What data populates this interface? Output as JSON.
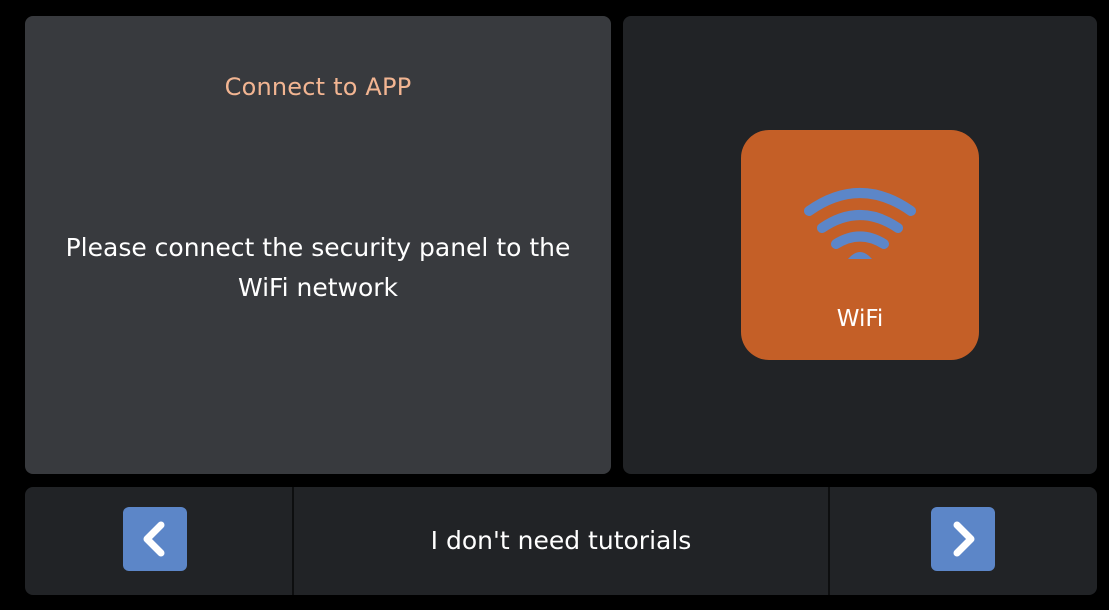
{
  "colors": {
    "background": "#000000",
    "left_panel": "#383a3e",
    "right_panel": "#212326",
    "title_accent": "#f2b592",
    "wifi_tile": "#c45f27",
    "wifi_icon": "#5c86c8",
    "nav_button": "#5c86c8"
  },
  "connect": {
    "title": "Connect to APP",
    "message_line1": "Please connect the security panel to the",
    "message_line2": "WiFi network"
  },
  "wifi": {
    "label": "WiFi",
    "icon": "wifi-icon"
  },
  "footer": {
    "prev_icon": "chevron-left-icon",
    "skip_label": "I don't need tutorials",
    "next_icon": "chevron-right-icon"
  }
}
